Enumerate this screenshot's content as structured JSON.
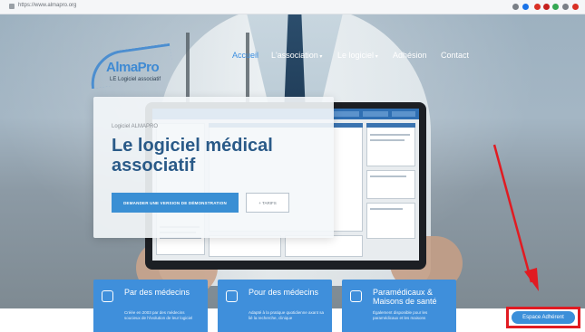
{
  "browser": {
    "url": "https://www.almapro.org",
    "ext_colors": [
      "#d93025",
      "#1a73e8",
      "#34a853",
      "#c5221f",
      "#7a7f86",
      "#f29900"
    ]
  },
  "logo": {
    "text": "AlmaPro",
    "subtitle": "LE Logiciel associatif"
  },
  "nav": {
    "items": [
      {
        "label": "Accueil",
        "active": true
      },
      {
        "label": "L'association",
        "caret": true
      },
      {
        "label": "Le logiciel",
        "caret": true
      },
      {
        "label": "Adhésion"
      },
      {
        "label": "Contact"
      }
    ]
  },
  "hero": {
    "label": "Logiciel ALMAPRO",
    "title": "Le logiciel médical associatif",
    "demo_button": "DEMANDER UNE VERSION DE DÉMONSTRATION",
    "tarifs_button": "+ TARIFS"
  },
  "cards": [
    {
      "icon": "medical-bag-icon",
      "title": "Par des médecins",
      "desc": "Créée en 2003 par des médecins soucieux de l'évolution de leur logiciel"
    },
    {
      "icon": "stethoscope-icon",
      "title": "Pour des médecins",
      "desc": "Adapté à la pratique quotidienne axant sa lié la recherche, clinique"
    },
    {
      "icon": "clipboard-icon",
      "title": "Paramédicaux & Maisons de santé",
      "desc": "Également disponible pour les paramédicaux et les maisons"
    }
  ],
  "adherent_button": "Espace Adhérent",
  "colors": {
    "accent": "#3b8fd9",
    "title": "#2a5a88",
    "highlight": "#e11b22"
  }
}
